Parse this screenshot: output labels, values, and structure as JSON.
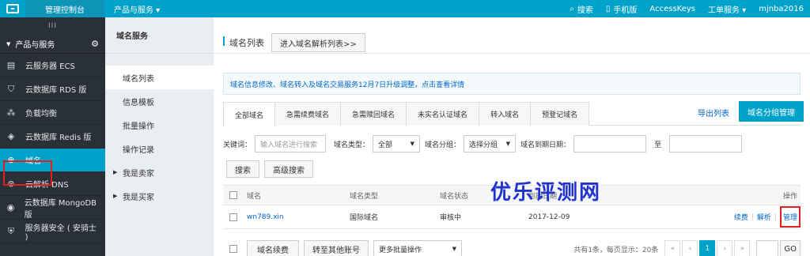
{
  "topbar": {
    "console": "管理控制台",
    "products": "产品与服务 ▾",
    "search": "搜索",
    "mobile": "手机版",
    "accesskeys": "AccessKeys",
    "ticket": "工单服务 ▾",
    "user": "mjnba2016"
  },
  "sidebar": {
    "collapse": "III",
    "group": "产品与服务",
    "items": [
      {
        "label": "云服务器 ECS",
        "icon": "server-icon"
      },
      {
        "label": "云数据库 RDS 版",
        "icon": "database-icon"
      },
      {
        "label": "负载均衡",
        "icon": "load-balancer-icon"
      },
      {
        "label": "云数据库 Redis 版",
        "icon": "redis-icon"
      },
      {
        "label": "域名",
        "icon": "globe-icon"
      },
      {
        "label": "云解析 DNS",
        "icon": "dns-icon"
      },
      {
        "label": "云数据库 MongoDB 版",
        "icon": "mongodb-icon"
      },
      {
        "label": "服务器安全 ( 安骑士 )",
        "icon": "shield-icon"
      }
    ]
  },
  "subnav": {
    "title": "域名服务",
    "items": [
      "域名列表",
      "信息模板",
      "批量操作",
      "操作记录",
      "我是卖家",
      "我是买家"
    ]
  },
  "main": {
    "title": "域名列表",
    "goto_dns": "进入域名解析列表>>",
    "notice": "域名信息修改、域名转入及域名交易服务12月7日升级调整，点击查看详情",
    "tabs": [
      "全部域名",
      "急需续费域名",
      "急需赎回域名",
      "未实名认证域名",
      "转入域名",
      "预登记域名"
    ],
    "export": "导出列表",
    "group_manage": "域名分组管理",
    "filters": {
      "keyword_label": "关键词：",
      "keyword_placeholder": "输入域名进行搜索",
      "type_label": "域名类型：",
      "type_value": "全部",
      "group_label": "域名分组：",
      "group_value": "选择分组",
      "expire_label": "域名到期日期：",
      "to": "至"
    },
    "search_btn": "搜索",
    "advanced_btn": "高级搜索",
    "table": {
      "headers": [
        "域名",
        "域名类型",
        "域名状态",
        "到期日期",
        "操作"
      ],
      "rows": [
        {
          "domain": "wn789.xin",
          "type": "国际域名",
          "status": "审核中",
          "expire": "2017-12-09",
          "renew": "续费",
          "resolve": "解析",
          "manage": "管理"
        }
      ]
    },
    "footer": {
      "renew_btn": "域名续费",
      "transfer_btn": "转至其他账号",
      "batch": "更多批量操作",
      "summary": "共有1条，每页显示：20条",
      "pages": [
        "«",
        "‹",
        "1",
        "›",
        "»"
      ],
      "go": "GO"
    }
  },
  "watermark": "优乐评测网"
}
